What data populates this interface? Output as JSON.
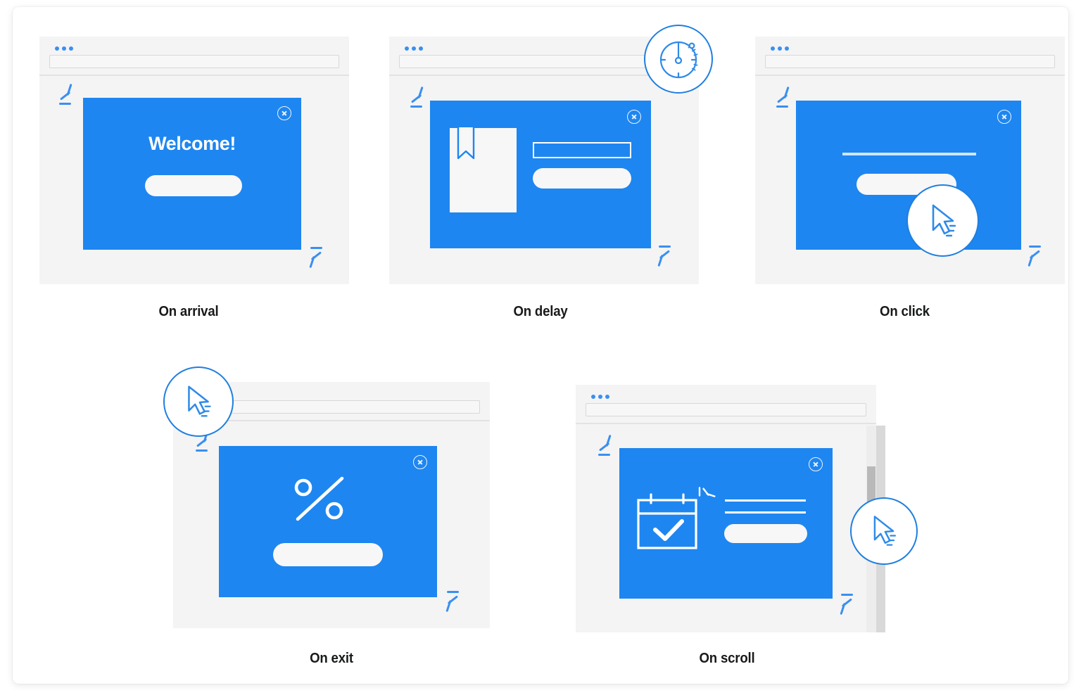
{
  "page": {
    "background": "#ffffff",
    "card_background": "#ffffff",
    "accent_blue": "#1e86f0",
    "icon_blue": "#1f7fe0",
    "chrome_gray": "#f4f4f4",
    "caption_color": "#18191a"
  },
  "panels": [
    {
      "id": "on-arrival",
      "caption": "On arrival",
      "modal_text": "Welcome!",
      "icons": [
        "close-icon",
        "sparkle-burst-icon"
      ],
      "modal_elements": [
        "heading",
        "cta-button"
      ]
    },
    {
      "id": "on-delay",
      "caption": "On delay",
      "badge_icon": "stopwatch-icon",
      "icons": [
        "close-icon",
        "sparkle-burst-icon",
        "document-bookmark-icon"
      ],
      "modal_elements": [
        "document-image",
        "input-field",
        "cta-button"
      ]
    },
    {
      "id": "on-click",
      "caption": "On click",
      "badge_icon": "cursor-icon",
      "icons": [
        "close-icon",
        "sparkle-burst-icon"
      ],
      "modal_elements": [
        "divider-line",
        "cta-button"
      ]
    },
    {
      "id": "on-exit",
      "caption": "On exit",
      "badge_icon": "cursor-icon",
      "icons": [
        "close-icon",
        "sparkle-burst-icon",
        "percent-icon"
      ],
      "modal_elements": [
        "percent-graphic",
        "cta-button"
      ]
    },
    {
      "id": "on-scroll",
      "caption": "On scroll",
      "badge_icon": "cursor-icon",
      "icons": [
        "close-icon",
        "sparkle-burst-icon",
        "calendar-check-icon",
        "scrollbar"
      ],
      "modal_elements": [
        "calendar-image",
        "text-lines",
        "cta-button"
      ]
    }
  ]
}
